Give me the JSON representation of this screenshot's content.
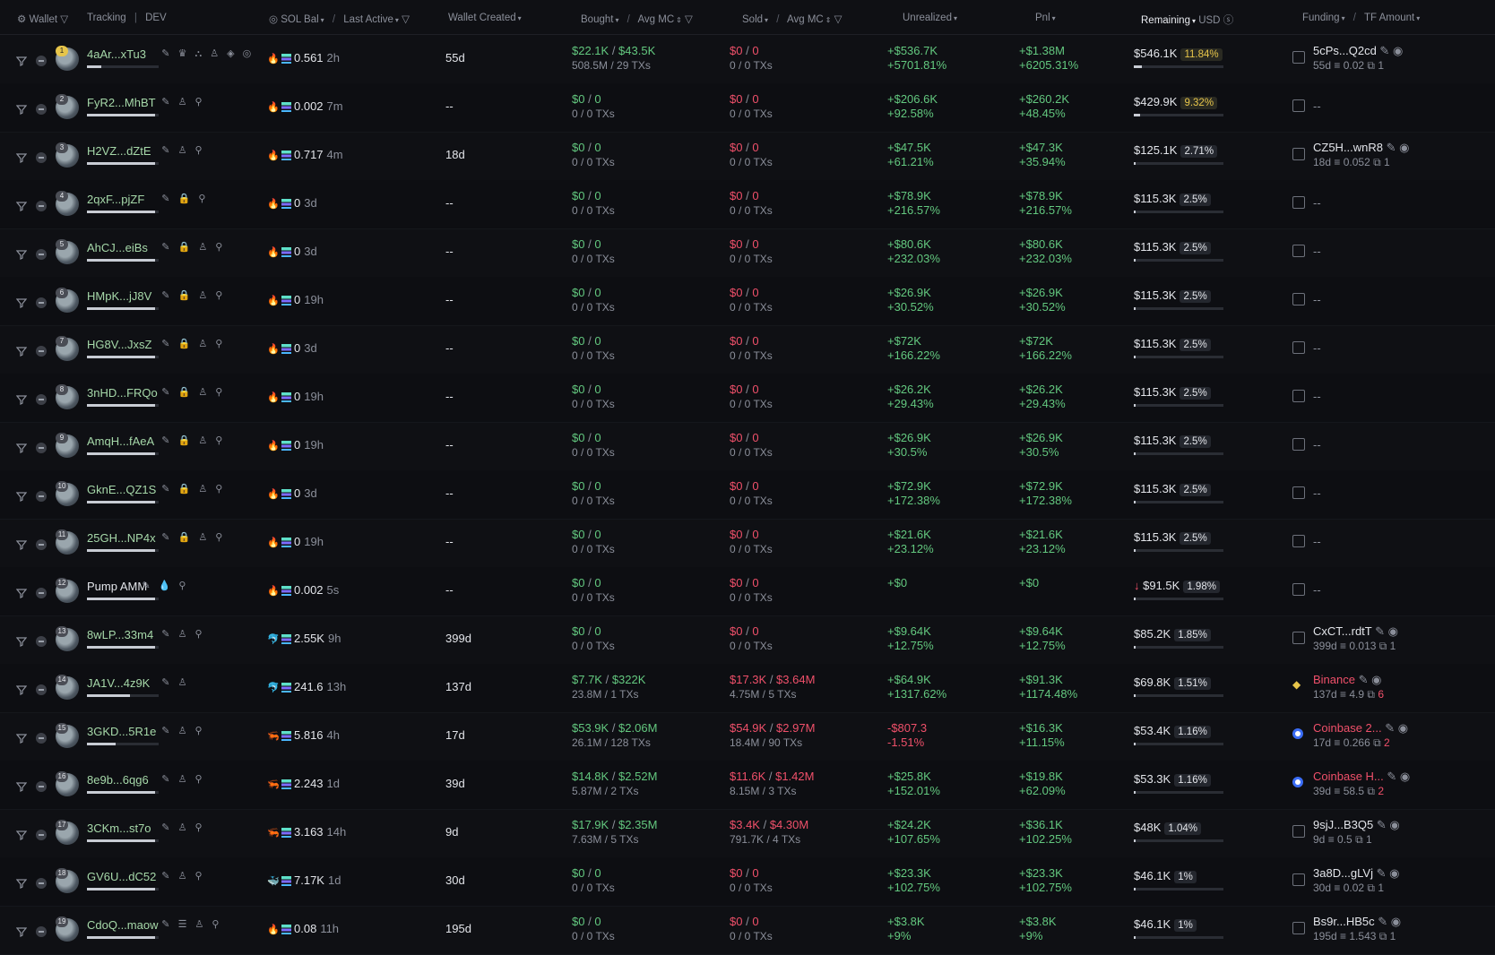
{
  "header": {
    "wallet": "Wallet",
    "tracking": "Tracking",
    "dev": "DEV",
    "sol_bal": "SOL Bal",
    "last_active": "Last Active",
    "wallet_created": "Wallet Created",
    "bought": "Bought",
    "avg_mc": "Avg MC",
    "sold": "Sold",
    "unrealized": "Unrealized",
    "pnl": "Pnl",
    "remaining": "Remaining",
    "usd": "USD",
    "funding": "Funding",
    "tf_amount": "TF Amount"
  },
  "rows": [
    {
      "rank": "1",
      "name": "4aAr...xTu3",
      "icons": "✎ ♛ ⛬ ♙ ◈ ◎",
      "bar": 0.2,
      "sol": "0.561",
      "last": "2h",
      "created": "55d",
      "bought": "$22.1K",
      "bought_mc": "$43.5K",
      "bought_sub": "508.5M / 29 TXs",
      "sold": "$0",
      "sold_mc": "0",
      "sold_sub": "0 / 0 TXs",
      "unreal": "+$536.7K",
      "unreal_pct": "+5701.81%",
      "pnl": "+$1.38M",
      "pnl_pct": "+6205.31%",
      "remain": "$546.1K",
      "remain_pct": "11.84%",
      "rfill": 0.11,
      "fund": "5cPs...Q2cd",
      "fund_d": "55d",
      "fund_amt": "0.02",
      "fund_cnt": "1"
    },
    {
      "rank": "2",
      "name": "FyR2...MhBT",
      "icons": "✎ ♙ ⚲",
      "bar": 0.95,
      "sol": "0.002",
      "last": "7m",
      "created": "--",
      "bought": "$0",
      "bought_mc": "0",
      "bought_sub": "0 / 0 TXs",
      "sold": "$0",
      "sold_mc": "0",
      "sold_sub": "0 / 0 TXs",
      "unreal": "+$206.6K",
      "unreal_pct": "+92.58%",
      "pnl": "+$260.2K",
      "pnl_pct": "+48.45%",
      "remain": "$429.9K",
      "remain_pct": "9.32%",
      "rfill": 0.09,
      "fund": "--"
    },
    {
      "rank": "3",
      "name": "H2VZ...dZtE",
      "icons": "✎ ♙ ⚲",
      "bar": 0.95,
      "sol": "0.717",
      "last": "4m",
      "created": "18d",
      "bought": "$0",
      "bought_mc": "0",
      "bought_sub": "0 / 0 TXs",
      "sold": "$0",
      "sold_mc": "0",
      "sold_sub": "0 / 0 TXs",
      "unreal": "+$47.5K",
      "unreal_pct": "+61.21%",
      "pnl": "+$47.3K",
      "pnl_pct": "+35.94%",
      "remain": "$125.1K",
      "remain_pct": "2.71%",
      "rfill": 0.03,
      "fund": "CZ5H...wnR8",
      "fund_d": "18d",
      "fund_amt": "0.052",
      "fund_cnt": "1"
    },
    {
      "rank": "4",
      "name": "2qxF...pjZF",
      "icons": "✎ 🔒 ⚲",
      "bar": 0.95,
      "sol": "0",
      "last": "3d",
      "created": "--",
      "bought": "$0",
      "bought_mc": "0",
      "bought_sub": "0 / 0 TXs",
      "sold": "$0",
      "sold_mc": "0",
      "sold_sub": "0 / 0 TXs",
      "unreal": "+$78.9K",
      "unreal_pct": "+216.57%",
      "pnl": "+$78.9K",
      "pnl_pct": "+216.57%",
      "remain": "$115.3K",
      "remain_pct": "2.5%",
      "rfill": 0.025,
      "fund": "--"
    },
    {
      "rank": "5",
      "name": "AhCJ...eiBs",
      "icons": "✎ 🔒 ♙ ⚲",
      "bar": 0.95,
      "sol": "0",
      "last": "3d",
      "created": "--",
      "bought": "$0",
      "bought_mc": "0",
      "bought_sub": "0 / 0 TXs",
      "sold": "$0",
      "sold_mc": "0",
      "sold_sub": "0 / 0 TXs",
      "unreal": "+$80.6K",
      "unreal_pct": "+232.03%",
      "pnl": "+$80.6K",
      "pnl_pct": "+232.03%",
      "remain": "$115.3K",
      "remain_pct": "2.5%",
      "rfill": 0.025,
      "fund": "--"
    },
    {
      "rank": "6",
      "name": "HMpK...jJ8V",
      "icons": "✎ 🔒 ♙ ⚲",
      "bar": 0.95,
      "sol": "0",
      "last": "19h",
      "created": "--",
      "bought": "$0",
      "bought_mc": "0",
      "bought_sub": "0 / 0 TXs",
      "sold": "$0",
      "sold_mc": "0",
      "sold_sub": "0 / 0 TXs",
      "unreal": "+$26.9K",
      "unreal_pct": "+30.52%",
      "pnl": "+$26.9K",
      "pnl_pct": "+30.52%",
      "remain": "$115.3K",
      "remain_pct": "2.5%",
      "rfill": 0.025,
      "fund": "--"
    },
    {
      "rank": "7",
      "name": "HG8V...JxsZ",
      "icons": "✎ 🔒 ♙ ⚲",
      "bar": 0.95,
      "sol": "0",
      "last": "3d",
      "created": "--",
      "bought": "$0",
      "bought_mc": "0",
      "bought_sub": "0 / 0 TXs",
      "sold": "$0",
      "sold_mc": "0",
      "sold_sub": "0 / 0 TXs",
      "unreal": "+$72K",
      "unreal_pct": "+166.22%",
      "pnl": "+$72K",
      "pnl_pct": "+166.22%",
      "remain": "$115.3K",
      "remain_pct": "2.5%",
      "rfill": 0.025,
      "fund": "--"
    },
    {
      "rank": "8",
      "name": "3nHD...FRQo",
      "icons": "✎ 🔒 ♙ ⚲",
      "bar": 0.95,
      "sol": "0",
      "last": "19h",
      "created": "--",
      "bought": "$0",
      "bought_mc": "0",
      "bought_sub": "0 / 0 TXs",
      "sold": "$0",
      "sold_mc": "0",
      "sold_sub": "0 / 0 TXs",
      "unreal": "+$26.2K",
      "unreal_pct": "+29.43%",
      "pnl": "+$26.2K",
      "pnl_pct": "+29.43%",
      "remain": "$115.3K",
      "remain_pct": "2.5%",
      "rfill": 0.025,
      "fund": "--"
    },
    {
      "rank": "9",
      "name": "AmqH...fAeA",
      "icons": "✎ 🔒 ♙ ⚲",
      "bar": 0.95,
      "sol": "0",
      "last": "19h",
      "created": "--",
      "bought": "$0",
      "bought_mc": "0",
      "bought_sub": "0 / 0 TXs",
      "sold": "$0",
      "sold_mc": "0",
      "sold_sub": "0 / 0 TXs",
      "unreal": "+$26.9K",
      "unreal_pct": "+30.5%",
      "pnl": "+$26.9K",
      "pnl_pct": "+30.5%",
      "remain": "$115.3K",
      "remain_pct": "2.5%",
      "rfill": 0.025,
      "fund": "--"
    },
    {
      "rank": "10",
      "name": "GknE...QZ1S",
      "icons": "✎ 🔒 ♙ ⚲",
      "bar": 0.95,
      "sol": "0",
      "last": "3d",
      "created": "--",
      "bought": "$0",
      "bought_mc": "0",
      "bought_sub": "0 / 0 TXs",
      "sold": "$0",
      "sold_mc": "0",
      "sold_sub": "0 / 0 TXs",
      "unreal": "+$72.9K",
      "unreal_pct": "+172.38%",
      "pnl": "+$72.9K",
      "pnl_pct": "+172.38%",
      "remain": "$115.3K",
      "remain_pct": "2.5%",
      "rfill": 0.025,
      "fund": "--"
    },
    {
      "rank": "11",
      "name": "25GH...NP4x",
      "icons": "✎ 🔒 ♙ ⚲",
      "bar": 0.95,
      "sol": "0",
      "last": "19h",
      "created": "--",
      "bought": "$0",
      "bought_mc": "0",
      "bought_sub": "0 / 0 TXs",
      "sold": "$0",
      "sold_mc": "0",
      "sold_sub": "0 / 0 TXs",
      "unreal": "+$21.6K",
      "unreal_pct": "+23.12%",
      "pnl": "+$21.6K",
      "pnl_pct": "+23.12%",
      "remain": "$115.3K",
      "remain_pct": "2.5%",
      "rfill": 0.025,
      "fund": "--"
    },
    {
      "rank": "12",
      "name": "Pump AMM",
      "icons": "✎ 💧 ⚲",
      "bar": 0.95,
      "white": true,
      "sol": "0.002",
      "last": "5s",
      "created": "--",
      "bought": "$0",
      "bought_mc": "0",
      "bought_sub": "0 / 0 TXs",
      "sold": "$0",
      "sold_mc": "0",
      "sold_sub": "0 / 0 TXs",
      "unreal": "+$0",
      "unreal_pct": "",
      "pnl": "+$0",
      "pnl_pct": "",
      "remain": "$91.5K",
      "remain_pct": "1.98%",
      "rfill": 0.02,
      "down": true,
      "fund": "--"
    },
    {
      "rank": "13",
      "name": "8wLP...33m4",
      "icons": "✎ ♙ ⚲",
      "bar": 0.95,
      "sol": "2.55K",
      "last": "9h",
      "solicon": "🐬",
      "created": "399d",
      "bought": "$0",
      "bought_mc": "0",
      "bought_sub": "0 / 0 TXs",
      "sold": "$0",
      "sold_mc": "0",
      "sold_sub": "0 / 0 TXs",
      "unreal": "+$9.64K",
      "unreal_pct": "+12.75%",
      "pnl": "+$9.64K",
      "pnl_pct": "+12.75%",
      "remain": "$85.2K",
      "remain_pct": "1.85%",
      "rfill": 0.02,
      "fund": "CxCT...rdtT",
      "fund_d": "399d",
      "fund_amt": "0.013",
      "fund_cnt": "1"
    },
    {
      "rank": "14",
      "name": "JA1V...4z9K",
      "icons": "✎ ♙",
      "bar": 0.6,
      "sol": "241.6",
      "last": "13h",
      "solicon": "🐬",
      "created": "137d",
      "bought": "$7.7K",
      "bought_mc": "$322K",
      "bought_sub": "23.8M / 1 TXs",
      "sold": "$17.3K",
      "sold_mc": "$3.64M",
      "sold_sub": "4.75M / 5 TXs",
      "unreal": "+$64.9K",
      "unreal_pct": "+1317.62%",
      "pnl": "+$91.3K",
      "pnl_pct": "+1174.48%",
      "remain": "$69.8K",
      "remain_pct": "1.51%",
      "rfill": 0.015,
      "fund": "Binance",
      "fund_type": "binance",
      "fund_red": true,
      "fund_d": "137d",
      "fund_amt": "4.9",
      "fund_cnt": "6",
      "cnt_red": true
    },
    {
      "rank": "15",
      "name": "3GKD...5R1e",
      "icons": "✎ ♙ ⚲",
      "bar": 0.4,
      "sol": "5.816",
      "last": "4h",
      "solicon": "🦐",
      "created": "17d",
      "bought": "$53.9K",
      "bought_mc": "$2.06M",
      "bought_sub": "26.1M / 128 TXs",
      "sold": "$54.9K",
      "sold_mc": "$2.97M",
      "sold_sub": "18.4M / 90 TXs",
      "unreal": "-$807.3",
      "unreal_pct": "-1.51%",
      "unreal_neg": true,
      "pnl": "+$16.3K",
      "pnl_pct": "+11.15%",
      "remain": "$53.4K",
      "remain_pct": "1.16%",
      "rfill": 0.012,
      "fund": "Coinbase 2...",
      "fund_type": "coinbase",
      "fund_red": true,
      "fund_d": "17d",
      "fund_amt": "0.266",
      "fund_cnt": "2",
      "cnt_red": true
    },
    {
      "rank": "16",
      "name": "8e9b...6qg6",
      "icons": "✎ ♙ ⚲",
      "bar": 0.95,
      "sol": "2.243",
      "last": "1d",
      "solicon": "🦐",
      "created": "39d",
      "bought": "$14.8K",
      "bought_mc": "$2.52M",
      "bought_sub": "5.87M / 2 TXs",
      "sold": "$11.6K",
      "sold_mc": "$1.42M",
      "sold_sub": "8.15M / 3 TXs",
      "unreal": "+$25.8K",
      "unreal_pct": "+152.01%",
      "pnl": "+$19.8K",
      "pnl_pct": "+62.09%",
      "remain": "$53.3K",
      "remain_pct": "1.16%",
      "rfill": 0.012,
      "fund": "Coinbase H...",
      "fund_type": "coinbase",
      "fund_red": true,
      "fund_d": "39d",
      "fund_amt": "58.5",
      "fund_cnt": "2",
      "cnt_red": true
    },
    {
      "rank": "17",
      "name": "3CKm...st7o",
      "icons": "✎ ♙ ⚲",
      "bar": 0.95,
      "sol": "3.163",
      "last": "14h",
      "solicon": "🦐",
      "created": "9d",
      "bought": "$17.9K",
      "bought_mc": "$2.35M",
      "bought_sub": "7.63M / 5 TXs",
      "sold": "$3.4K",
      "sold_mc": "$4.30M",
      "sold_sub": "791.7K / 4 TXs",
      "unreal": "+$24.2K",
      "unreal_pct": "+107.65%",
      "pnl": "+$36.1K",
      "pnl_pct": "+102.25%",
      "remain": "$48K",
      "remain_pct": "1.04%",
      "rfill": 0.01,
      "fund": "9sjJ...B3Q5",
      "fund_d": "9d",
      "fund_amt": "0.5",
      "fund_cnt": "1"
    },
    {
      "rank": "18",
      "name": "GV6U...dC52",
      "icons": "✎ ♙ ⚲",
      "bar": 0.95,
      "sol": "7.17K",
      "last": "1d",
      "solicon": "🐳",
      "created": "30d",
      "bought": "$0",
      "bought_mc": "0",
      "bought_sub": "0 / 0 TXs",
      "sold": "$0",
      "sold_mc": "0",
      "sold_sub": "0 / 0 TXs",
      "unreal": "+$23.3K",
      "unreal_pct": "+102.75%",
      "pnl": "+$23.3K",
      "pnl_pct": "+102.75%",
      "remain": "$46.1K",
      "remain_pct": "1%",
      "rfill": 0.01,
      "fund": "3a8D...gLVj",
      "fund_d": "30d",
      "fund_amt": "0.02",
      "fund_cnt": "1"
    },
    {
      "rank": "19",
      "name": "CdoQ...maow",
      "icons": "✎ ☰ ♙ ⚲",
      "bar": 0.95,
      "sol": "0.08",
      "last": "11h",
      "created": "195d",
      "bought": "$0",
      "bought_mc": "0",
      "bought_sub": "0 / 0 TXs",
      "sold": "$0",
      "sold_mc": "0",
      "sold_sub": "0 / 0 TXs",
      "unreal": "+$3.8K",
      "unreal_pct": "+9%",
      "pnl": "+$3.8K",
      "pnl_pct": "+9%",
      "remain": "$46.1K",
      "remain_pct": "1%",
      "rfill": 0.01,
      "fund": "Bs9r...HB5c",
      "fund_d": "195d",
      "fund_amt": "1.543",
      "fund_cnt": "1"
    }
  ]
}
